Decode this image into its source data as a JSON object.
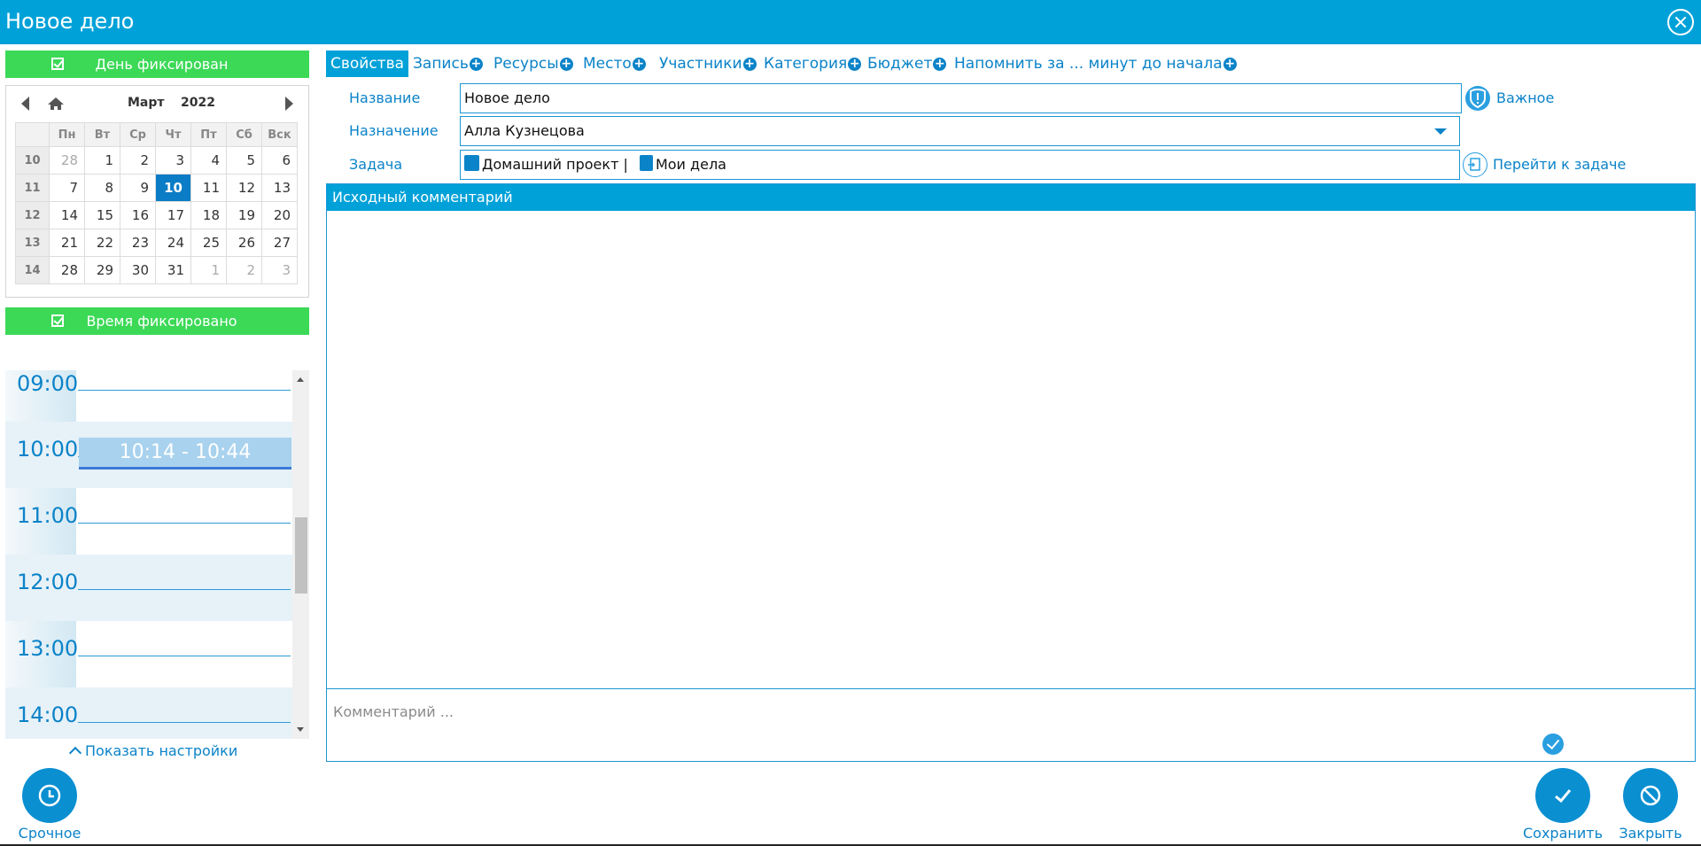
{
  "window": {
    "title": "Новое дело"
  },
  "left": {
    "day_fixed_label": "День фиксирован",
    "time_fixed_label": "Время фиксировано",
    "calendar": {
      "month": "Март",
      "year": "2022",
      "weekdays": [
        "Пн",
        "Вт",
        "Ср",
        "Чт",
        "Пт",
        "Сб",
        "Вск"
      ],
      "weeks": [
        {
          "num": "10",
          "days": [
            "28",
            "1",
            "2",
            "3",
            "4",
            "5",
            "6"
          ]
        },
        {
          "num": "11",
          "days": [
            "7",
            "8",
            "9",
            "10",
            "11",
            "12",
            "13"
          ]
        },
        {
          "num": "12",
          "days": [
            "14",
            "15",
            "16",
            "17",
            "18",
            "19",
            "20"
          ]
        },
        {
          "num": "13",
          "days": [
            "21",
            "22",
            "23",
            "24",
            "25",
            "26",
            "27"
          ]
        },
        {
          "num": "14",
          "days": [
            "28",
            "29",
            "30",
            "31",
            "1",
            "2",
            "3"
          ]
        }
      ],
      "selected_day": "10"
    },
    "schedule": {
      "hours": [
        "09:00",
        "10:00",
        "11:00",
        "12:00",
        "13:00",
        "14:00"
      ],
      "event": "10:14 - 10:44"
    },
    "show_settings": "Показать настройки",
    "urgent_label": "Срочное"
  },
  "tabs": [
    {
      "label": "Свойства",
      "active": true
    },
    {
      "label": "Запись"
    },
    {
      "label": "Ресурсы"
    },
    {
      "label": "Место"
    },
    {
      "label": "Участники"
    },
    {
      "label": "Категория"
    },
    {
      "label": "Бюджет"
    },
    {
      "label": "Напомнить за ... минут до начала"
    }
  ],
  "form": {
    "name_label": "Название",
    "name_value": "Новое дело",
    "assign_label": "Назначение",
    "assign_value": "Алла Кузнецова",
    "task_label": "Задача",
    "task_project": "Домашний проект |",
    "task_list": "Мои дела",
    "important_label": "Важное",
    "goto_task_label": "Перейти к задаче"
  },
  "comment": {
    "header": "Исходный комментарий",
    "placeholder": "Комментарий ..."
  },
  "footer": {
    "save_label": "Сохранить",
    "close_label": "Закрыть"
  },
  "colors": {
    "accent": "#00a1d8",
    "green": "#3cd957",
    "link": "#0b83c8"
  }
}
